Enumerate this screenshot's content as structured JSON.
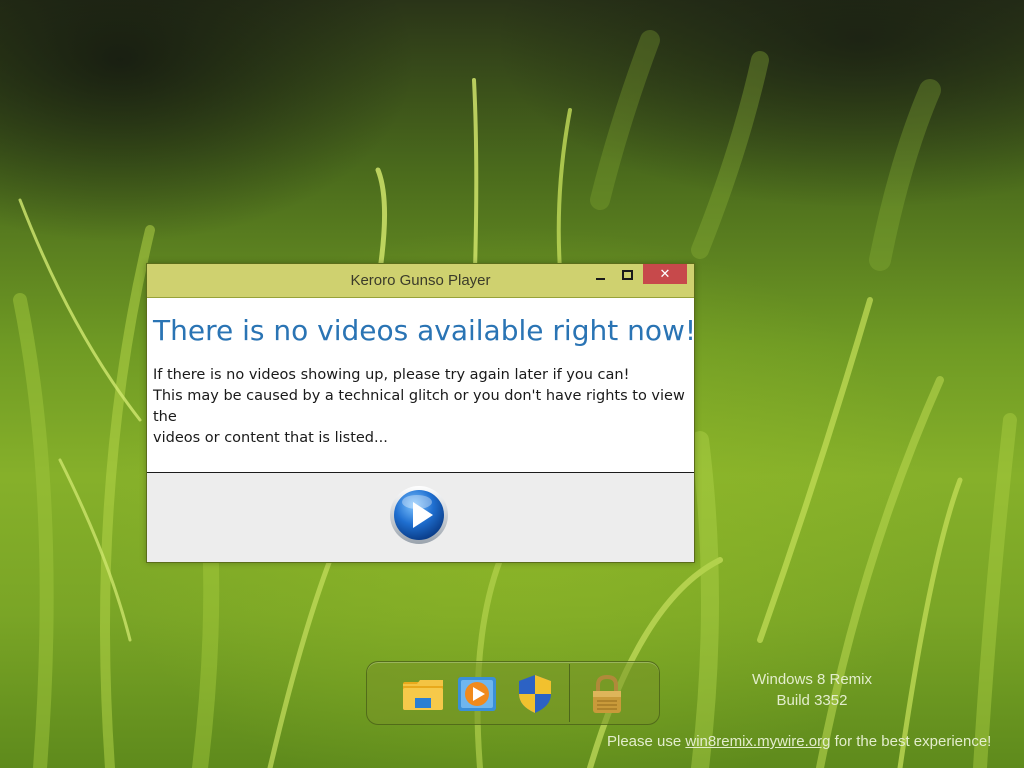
{
  "window": {
    "title": "Keroro Gunso Player",
    "close_glyph": "✕",
    "heading": "There is no videos available right now!",
    "message_lines": [
      "If there is no videos showing up, please try again later if you can!",
      "This may be caused by a technical glitch or you don't have rights to view the",
      "videos or content that is listed..."
    ],
    "play_icon": "play-icon",
    "accent_color": "#2a74b4",
    "titlebar_color": "#cfd16f",
    "close_color": "#c7494b"
  },
  "taskbar": {
    "icons": [
      "file-explorer-icon",
      "media-player-icon",
      "security-shield-icon",
      "lock-icon"
    ]
  },
  "watermark": {
    "line1": "Windows 8 Remix",
    "line2": "Build 3352"
  },
  "promo": {
    "prefix": "Please use ",
    "link": "win8remix.mywire.org",
    "suffix": " for the best experience!"
  }
}
